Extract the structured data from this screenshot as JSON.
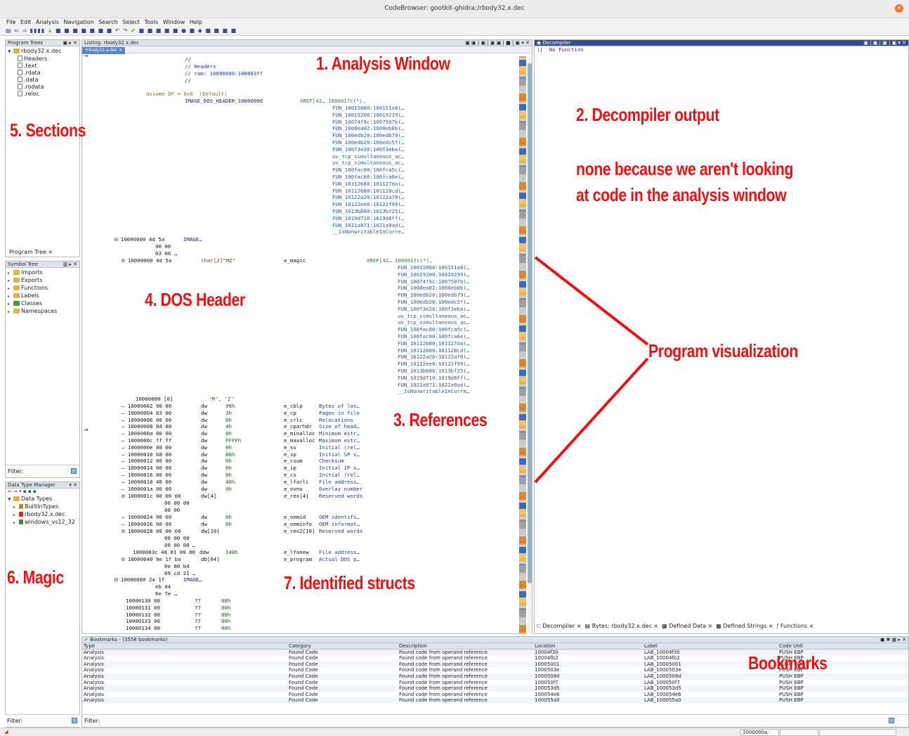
{
  "window": {
    "title": "CodeBrowser: gootkit-ghidra:/rbody32.x.dec",
    "close_glyph": "×"
  },
  "menu": [
    "File",
    "Edit",
    "Analysis",
    "Navigation",
    "Search",
    "Select",
    "Tools",
    "Window",
    "Help"
  ],
  "program_trees": {
    "title": "Program Trees",
    "root": "rbody32.x.dec",
    "items": [
      "Headers",
      ".text",
      ".rdata",
      ".data",
      ".rodata",
      ".reloc"
    ],
    "tab": "Program Tree ×"
  },
  "symbol_tree": {
    "title": "Symbol Tree",
    "items": [
      "Imports",
      "Exports",
      "Functions",
      "Labels",
      "Classes",
      "Namespaces"
    ],
    "filter_label": "Filter:"
  },
  "data_type_manager": {
    "title": "Data Type Manager",
    "root": "Data Types",
    "items": [
      "BuiltInTypes",
      "rbody32.x.dec",
      "windows_vs12_32"
    ],
    "filter_label": "Filter:"
  },
  "listing": {
    "title": "Listing: rbody32.x.dec",
    "tab": "*rbody32.x.dec",
    "header_comments": [
      "//",
      "// Headers",
      "// ram: 10000000-100003ff",
      "//"
    ],
    "assume": "assume DF = 0x0  (Default)",
    "label": "IMAGE_DOS_HEADER_10000000",
    "xref_head": "XREF[42… 1000017c(*),",
    "xrefs1": [
      "FUN_10015080:100151a8(…",
      "FUN_10019200:10019239(…",
      "FUN_10074f9c:1007507b(…",
      "FUN_1008ea02:1008eb0b(…",
      "FUN_100edb20:100edb79(…",
      "FUN_100edb20:100edc5f(…",
      "FUN_100f3e20:100f3eba(…",
      "uv_tcp_simultaneous_ac…",
      "uv_tcp_simultaneous_ac…",
      "FUN_100fac00:100fca5c(…",
      "FUN_100fac00:100fca6e(…",
      "FUN_10112680:101127da(…",
      "FUN_10112680:101128cd(…",
      "FUN_10122a20:10122a70(…",
      "FUN_10122ee0:10122f99(…",
      "FUN_1013b680:1013bf25(…",
      "FUN_1019d710:1019d8ff(…",
      "FUN_1021a971:1021a9ad(…",
      "__IsNonwritableInCurre…"
    ],
    "image_row": {
      "addr": "10000000",
      "bytes": "4d 5a",
      "lbl": "IMAGE…",
      "more1": "90 00",
      "more2": "03 00 …"
    },
    "magic_row": {
      "addr": "10000000",
      "bytes": "4d 5a",
      "type": "char[2]\"MZ\"",
      "name": "e_magic",
      "xref": "XREF[42… 1000017c(*),"
    },
    "xrefs2": [
      "FUN_10015080:100151a8(…",
      "FUN_10019200:10019239(…",
      "FUN_10074f9c:1007507b(…",
      "FUN_1008ea02:1008eb0b(…",
      "FUN_100edb20:100edb79(…",
      "FUN_100edb20:100edc5f(…",
      "FUN_100f3e20:100f3eba(…",
      "uv_tcp_simultaneous_ac…",
      "uv_tcp_simultaneous_ac…",
      "FUN_100fac00:100fca5c(…",
      "FUN_100fac00:100fca6e(…",
      "FUN_10112680:101127da(…",
      "FUN_10112680:101128cd(…",
      "FUN_10122a20:10122a70(…",
      "FUN_10122ee0:10122f99(…",
      "FUN_1013b680:1013bf25(…",
      "FUN_1019d710:1019d8ff(…",
      "FUN_1021a971:1021a9ad(…",
      "__IsNonwritableInCurre…"
    ],
    "mz_row": {
      "addr": "10000000 [0]",
      "val": "'M', 'Z'"
    },
    "fields": [
      [
        "10000002",
        "90 00",
        "dw",
        "90h",
        "e_cblp",
        "Bytes of las…"
      ],
      [
        "10000004",
        "03 00",
        "dw",
        "3h",
        "e_cp",
        "Pages in file"
      ],
      [
        "10000006",
        "00 00",
        "dw",
        "0h",
        "e_crlc",
        "Relocations"
      ],
      [
        "10000008",
        "04 00",
        "dw",
        "4h",
        "e_cparhdr",
        "Size of head…"
      ],
      [
        "1000000a",
        "00 00",
        "dw",
        "0h",
        "e_minalloc",
        "Minimum extr…"
      ],
      [
        "1000000c",
        "ff ff",
        "dw",
        "FFFFh",
        "e_maxalloc",
        "Maximum extr…"
      ],
      [
        "1000000e",
        "00 00",
        "dw",
        "0h",
        "e_ss",
        "Initial (rel…"
      ],
      [
        "10000010",
        "b8 00",
        "dw",
        "B8h",
        "e_sp",
        "Initial SP v…"
      ],
      [
        "10000012",
        "00 00",
        "dw",
        "0h",
        "e_csum",
        "Checksum"
      ],
      [
        "10000014",
        "00 00",
        "dw",
        "0h",
        "e_ip",
        "Initial IP v…"
      ],
      [
        "10000016",
        "00 00",
        "dw",
        "0h",
        "e_cs",
        "Initial (rel…"
      ],
      [
        "10000018",
        "40 00",
        "dw",
        "40h",
        "e_lfarlc",
        "File address…"
      ],
      [
        "1000001a",
        "00 00",
        "dw",
        "0h",
        "e_ovno",
        "Overlay number"
      ]
    ],
    "res_row": {
      "addr": "1000001c",
      "bytes": "00 00 00",
      "type": "dw[4]",
      "name": "e_res[4]",
      "desc": "Reserved words",
      "more1": "00 00 00",
      "more2": "00 00"
    },
    "oem_rows": [
      [
        "10000024",
        "00 00",
        "dw",
        "0h",
        "e_oemid",
        "OEM identifi…"
      ],
      [
        "10000026",
        "00 00",
        "dw",
        "0h",
        "e_oeminfo",
        "OEM informat…"
      ]
    ],
    "res2_row": {
      "addr": "10000028",
      "bytes": "00 00 00",
      "type": "dw[10]",
      "name": "e_res2[10]",
      "desc": "Reserved words",
      "more1": "00 00 00",
      "more2": "00 00 00 …"
    },
    "lfanew_row": {
      "addr": "1000003c",
      "bytes": "48 01 00 00",
      "type": "ddw",
      "val": "148h",
      "name": "e_lfanew",
      "desc": "File address…"
    },
    "program_row": {
      "addr": "10000040",
      "bytes": "0e 1f ba",
      "type": "db[64]",
      "name": "e_program",
      "desc": "Actual DOS p…",
      "more1": "0e 00 b4",
      "more2": "09 cd 21 …"
    },
    "image2_row": {
      "addr": "10000080",
      "bytes": "2a 1f",
      "lbl": "IMAGE…",
      "more1": "eb 04",
      "more2": "6e 7e …"
    },
    "tail_rows": [
      [
        "10000130",
        "00",
        "??",
        "00h"
      ],
      [
        "10000131",
        "00",
        "??",
        "00h"
      ],
      [
        "10000132",
        "00",
        "??",
        "00h"
      ],
      [
        "10000133",
        "00",
        "??",
        "00h"
      ],
      [
        "10000134",
        "00",
        "??",
        "00h"
      ]
    ]
  },
  "decompiler": {
    "title": "Decompiler",
    "line_no": "1",
    "text": "No Function",
    "tabs": [
      "Decompiler ×",
      "Bytes: rbody32.x.dec ×",
      "Defined Data ×",
      "Defined Strings ×",
      "Functions ×"
    ]
  },
  "bookmarks": {
    "title": "Bookmarks - (3558 bookmarks)",
    "columns": [
      "Type",
      "Category",
      "Description",
      "Location",
      "Label",
      "Code Unit"
    ],
    "rows": [
      [
        "Analysis",
        "Found Code",
        "Found code from operand reference",
        "10004f30",
        "LAB_10004f30",
        "PUSH EBP"
      ],
      [
        "Analysis",
        "Found Code",
        "Found code from operand reference",
        "10004fb2",
        "LAB_10004fb2",
        "PUSH EBP"
      ],
      [
        "Analysis",
        "Found Code",
        "Found code from operand reference",
        "10005001",
        "LAB_10005001",
        "PUSH EBP"
      ],
      [
        "Analysis",
        "Found Code",
        "Found code from operand reference",
        "1000503e",
        "LAB_1000503e",
        "PUSH EBP"
      ],
      [
        "Analysis",
        "Found Code",
        "Found code from operand reference",
        "1000508d",
        "LAB_1000508d",
        "PUSH EBP"
      ],
      [
        "Analysis",
        "Found Code",
        "Found code from operand reference",
        "100050f7",
        "LAB_100050f7",
        "PUSH EBP"
      ],
      [
        "Analysis",
        "Found Code",
        "Found code from operand reference",
        "100053d5",
        "LAB_100053d5",
        "PUSH EBP"
      ],
      [
        "Analysis",
        "Found Code",
        "Found code from operand reference",
        "100054e6",
        "LAB_100054e6",
        "PUSH EBP"
      ],
      [
        "Analysis",
        "Found Code",
        "Found code from operand reference",
        "100055a0",
        "LAB_100055a0",
        "PUSH EBP"
      ]
    ],
    "filter_label": "Filter:"
  },
  "annotations": {
    "analysis": "1. Analysis Window",
    "decompiler": "2. Decompiler output",
    "decompiler_note1": "none because we aren't looking",
    "decompiler_note2": "at code in the analysis window",
    "references": "3. References",
    "dos_header": "4. DOS Header",
    "sections": "5. Sections",
    "magic": "6. Magic",
    "structs": "7. Identified structs",
    "visualization": "Program visualization",
    "bookmarks": "Bookmarks"
  },
  "colors": {
    "annotation": "#ee1111",
    "accent": "#314e8f"
  },
  "status": {
    "address": "1000000a"
  }
}
